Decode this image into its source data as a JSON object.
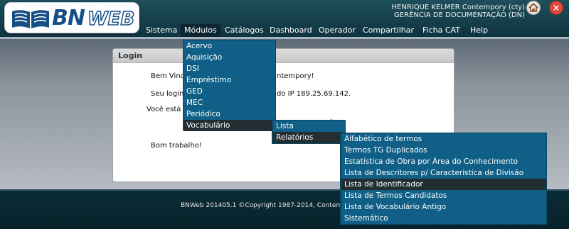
{
  "app": {
    "logo_text_bn": "BN",
    "logo_text_web": "WEB",
    "user_name": "HENRIQUE KELMER Contempory (cty)",
    "user_dept": "GERÊNCIA DE DOCUMENTAÇÃO (DN)",
    "close_glyph": "×"
  },
  "menubar": [
    {
      "label": "Sistema"
    },
    {
      "label": "Módulos"
    },
    {
      "label": "Catálogos"
    },
    {
      "label": "Dashboard"
    },
    {
      "label": "Operador"
    },
    {
      "label": "Compartilhar"
    },
    {
      "label": "Ficha CAT"
    },
    {
      "label": "Help"
    }
  ],
  "login": {
    "title": "Login",
    "line1_left": "Bem Vind",
    "line1_right": "ntempory!",
    "line2_left": "Seu login",
    "line2_right": "do IP 189.25.69.142.",
    "line3_left": "Você está",
    "line3_right": "o.",
    "bye": "Bom trabalho!"
  },
  "modulos_menu": [
    "Acervo",
    "Aquisição",
    "DSI",
    "Empréstimo",
    "GED",
    "MEC",
    "Periódico",
    "Vocabulário"
  ],
  "vocab_menu": [
    "Lista",
    "Relatórios"
  ],
  "relatorios_menu": [
    "Alfabético de termos",
    "Termos TG Duplicados",
    "Estatística de Obra por Área do Conhecimento",
    "Lista de Descritores p/ Caracteristica de Divisão",
    "Lista de Identificador",
    "Lista de Termos Candidatos",
    "Lista de Vocabulário Antigo",
    "Sistemático"
  ],
  "footer": {
    "text": "BNWeb 201405.1 ©Copyright 1987-2014, Contemp"
  },
  "colors": {
    "menu_bg": "#0f5f86",
    "menu_selected": "#232e33",
    "header": "#153e4a"
  }
}
